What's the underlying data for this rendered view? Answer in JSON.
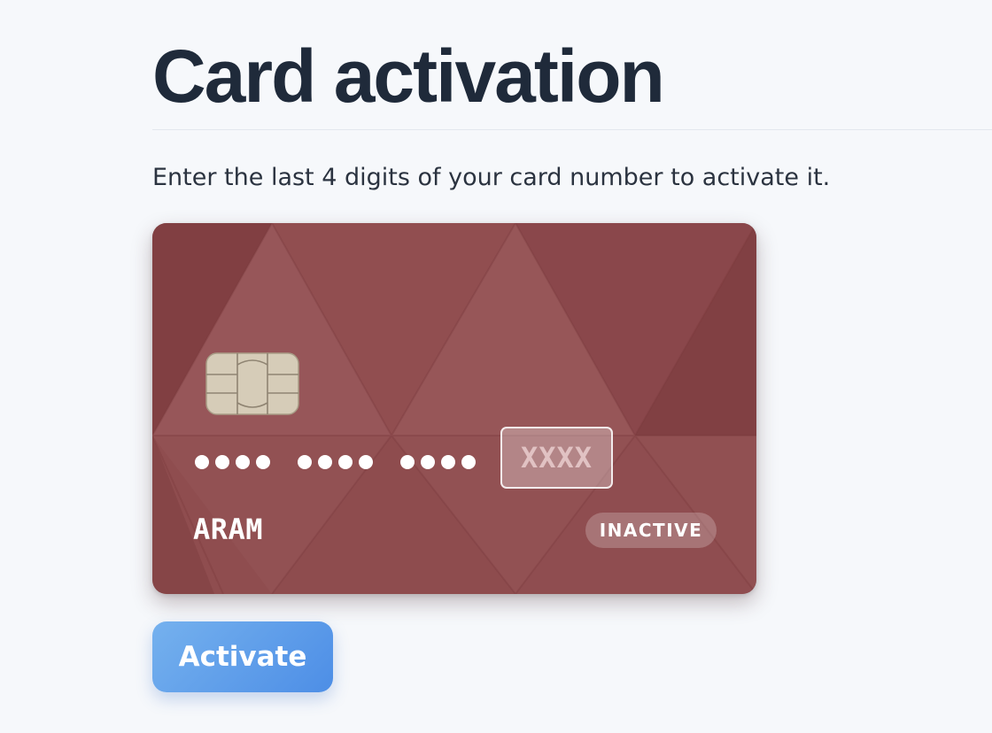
{
  "page": {
    "title": "Card activation",
    "instructions": "Enter the last 4 digits of your card number to activate it."
  },
  "card": {
    "masked_groups": 3,
    "last4_placeholder": "XXXX",
    "last4_value": "",
    "holder_name": "ARAM",
    "status": "INACTIVE",
    "card_color": "#8f4d4f",
    "chip_color": "#d6ccb8"
  },
  "actions": {
    "activate_label": "Activate",
    "button_color": "#5a97e8"
  }
}
